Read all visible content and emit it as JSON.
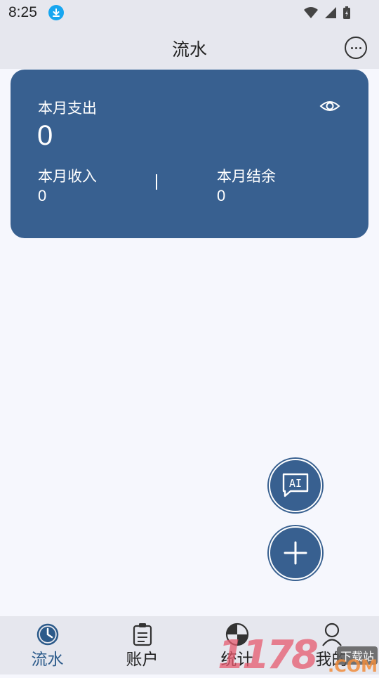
{
  "status_bar": {
    "time": "8:25"
  },
  "app_bar": {
    "title": "流水",
    "more_icon": "more-horizontal-circle-icon"
  },
  "summary": {
    "expense_label": "本月支出",
    "expense_value": "0",
    "income_label": "本月收入",
    "income_value": "0",
    "balance_label": "本月结余",
    "balance_value": "0",
    "eye_icon": "eye-icon"
  },
  "fab": {
    "ai_label": "AI",
    "add_icon": "plus-icon"
  },
  "bottom_nav": {
    "items": [
      {
        "label": "流水",
        "icon": "clock-history-icon",
        "active": true
      },
      {
        "label": "账户",
        "icon": "clipboard-icon",
        "active": false
      },
      {
        "label": "统计",
        "icon": "pie-chart-icon",
        "active": false
      },
      {
        "label": "我的",
        "icon": "person-icon",
        "active": false
      }
    ]
  },
  "watermark": {
    "digits": "1178",
    "sub": "下载站",
    "com": ".COM"
  },
  "colors": {
    "primary": "#386090",
    "background": "#f6f7fd",
    "bar": "#e6e7ee",
    "download_badge": "#17a6f0"
  }
}
